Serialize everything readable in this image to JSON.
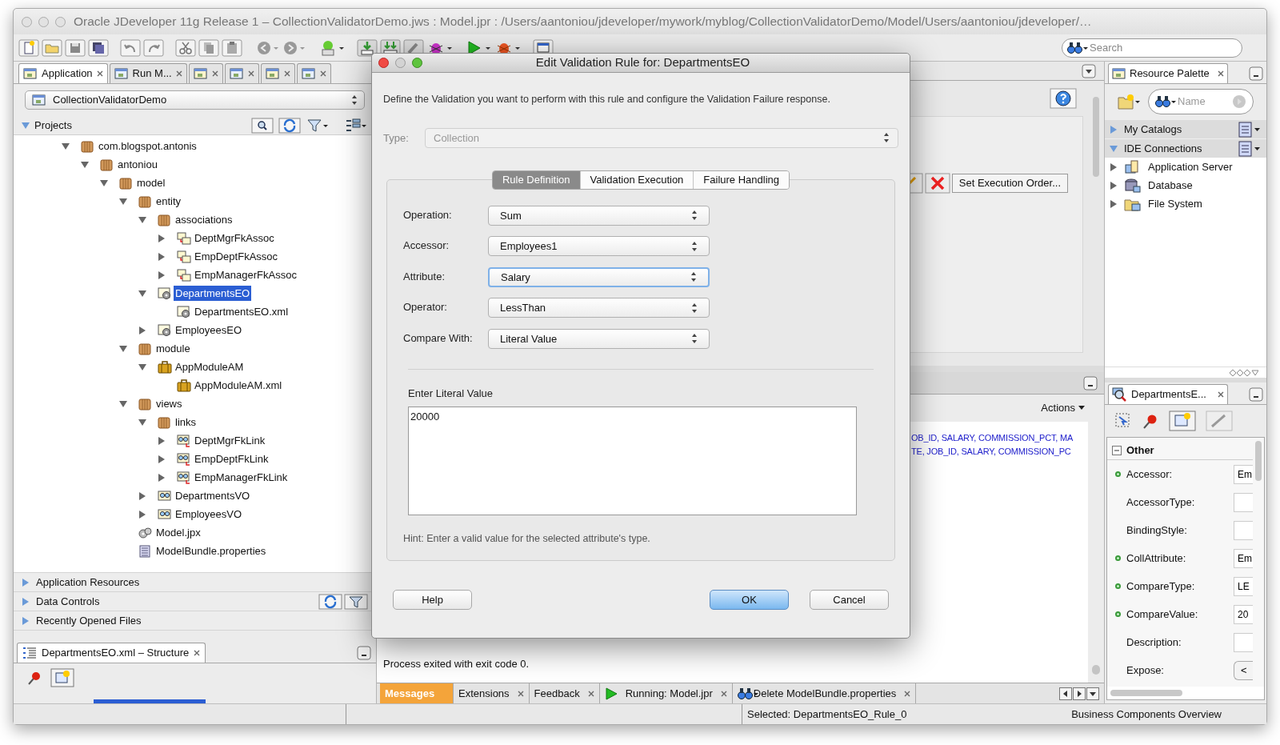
{
  "window": {
    "title": "Oracle JDeveloper 11g Release 1 – CollectionValidatorDemo.jws : Model.jpr : /Users/aantoniou/jdeveloper/mywork/myblog/CollectionValidatorDemo/Model/Users/aantoniou/jdeveloper/…"
  },
  "toolbar": {
    "search": {
      "placeholder": "Search"
    }
  },
  "navigator": {
    "tabs": [
      {
        "label": "Application",
        "selected": true
      },
      {
        "label": "Run M...",
        "selected": false
      },
      {
        "selected": false
      },
      {
        "selected": false
      },
      {
        "selected": false
      },
      {
        "selected": false
      }
    ],
    "application": "CollectionValidatorDemo",
    "projects_header": "Projects",
    "tree": [
      {
        "label": "com.blogspot.antonis",
        "kind": "package",
        "expanded": true,
        "selected": false,
        "children": [
          {
            "label": "antoniou",
            "kind": "package",
            "expanded": true,
            "selected": false,
            "children": [
              {
                "label": "model",
                "kind": "package",
                "expanded": true,
                "selected": false,
                "children": [
                  {
                    "label": "entity",
                    "kind": "package",
                    "expanded": true,
                    "selected": false,
                    "children": [
                      {
                        "label": "associations",
                        "kind": "package",
                        "expanded": true,
                        "selected": false,
                        "children": [
                          {
                            "label": "DeptMgrFkAssoc",
                            "kind": "association",
                            "expanded": false,
                            "selected": false
                          },
                          {
                            "label": "EmpDeptFkAssoc",
                            "kind": "association",
                            "expanded": false,
                            "selected": false
                          },
                          {
                            "label": "EmpManagerFkAssoc",
                            "kind": "association",
                            "expanded": false,
                            "selected": false
                          }
                        ]
                      },
                      {
                        "label": "DepartmentsEO",
                        "kind": "entity",
                        "expanded": true,
                        "selected": true,
                        "children": [
                          {
                            "label": "DepartmentsEO.xml",
                            "kind": "entity",
                            "selected": false
                          }
                        ]
                      },
                      {
                        "label": "EmployeesEO",
                        "kind": "entity",
                        "expanded": false,
                        "selected": false
                      }
                    ]
                  },
                  {
                    "label": "module",
                    "kind": "package",
                    "expanded": true,
                    "selected": false,
                    "children": [
                      {
                        "label": "AppModuleAM",
                        "kind": "module",
                        "expanded": true,
                        "selected": false,
                        "children": [
                          {
                            "label": "AppModuleAM.xml",
                            "kind": "module",
                            "selected": false
                          }
                        ]
                      }
                    ]
                  },
                  {
                    "label": "views",
                    "kind": "package",
                    "expanded": true,
                    "selected": false,
                    "children": [
                      {
                        "label": "links",
                        "kind": "package",
                        "expanded": true,
                        "selected": false,
                        "children": [
                          {
                            "label": "DeptMgrFkLink",
                            "kind": "link",
                            "expanded": false,
                            "selected": false
                          },
                          {
                            "label": "EmpDeptFkLink",
                            "kind": "link",
                            "expanded": false,
                            "selected": false
                          },
                          {
                            "label": "EmpManagerFkLink",
                            "kind": "link",
                            "expanded": false,
                            "selected": false
                          }
                        ]
                      },
                      {
                        "label": "DepartmentsVO",
                        "kind": "view",
                        "expanded": false,
                        "selected": false
                      },
                      {
                        "label": "EmployeesVO",
                        "kind": "view",
                        "expanded": false,
                        "selected": false
                      }
                    ]
                  },
                  {
                    "label": "Model.jpx",
                    "kind": "project",
                    "selected": false
                  },
                  {
                    "label": "ModelBundle.properties",
                    "kind": "properties",
                    "selected": false
                  }
                ]
              }
            ]
          }
        ]
      }
    ],
    "accordions": [
      {
        "label": "Application Resources",
        "expanded": false
      },
      {
        "label": "Data Controls",
        "expanded": false
      },
      {
        "label": "Recently Opened Files",
        "expanded": false
      }
    ]
  },
  "structure": {
    "tab": "DepartmentsEO.xml – Structure"
  },
  "editor": {
    "button": "Set Execution Order..."
  },
  "log": {
    "actions": "Actions",
    "lines": [
      "OB_ID, SALARY, COMMISSION_PCT, MA",
      "TE, JOB_ID, SALARY, COMMISSION_PC"
    ],
    "exit_message": "Process exited with exit code 0.",
    "tabs": [
      {
        "label": "Messages",
        "kind": "plain",
        "selected": true
      },
      {
        "label": "Extensions",
        "kind": "plain",
        "selected": false
      },
      {
        "label": "Feedback",
        "kind": "plain",
        "selected": false
      },
      {
        "label": "Running: Model.jpr",
        "kind": "run",
        "selected": false
      },
      {
        "label": "Delete ModelBundle.properties",
        "kind": "find",
        "selected": false
      }
    ]
  },
  "resource_palette": {
    "tab": "Resource Palette",
    "search": {
      "placeholder": "Name"
    },
    "sections": [
      {
        "label": "My Catalogs",
        "expanded": false
      },
      {
        "label": "IDE Connections",
        "expanded": true,
        "children": [
          {
            "label": "Application Server",
            "kind": "server"
          },
          {
            "label": "Database",
            "kind": "database"
          },
          {
            "label": "File System",
            "kind": "folder"
          }
        ]
      }
    ]
  },
  "inspector": {
    "tab": "DepartmentsE...",
    "group": "Other",
    "properties": [
      {
        "name": "Accessor:",
        "required": true,
        "kind": "field",
        "value": "Em"
      },
      {
        "name": "AccessorType:",
        "required": false,
        "kind": "field"
      },
      {
        "name": "BindingStyle:",
        "required": false,
        "kind": "field"
      },
      {
        "name": "CollAttribute:",
        "required": true,
        "kind": "field",
        "value": "Em"
      },
      {
        "name": "CompareType:",
        "required": true,
        "kind": "field",
        "value": "LE"
      },
      {
        "name": "CompareValue:",
        "required": true,
        "kind": "field",
        "value": "20"
      },
      {
        "name": "Description:",
        "required": false,
        "kind": "field"
      },
      {
        "name": "Expose:",
        "required": false,
        "kind": "button",
        "value": "<"
      }
    ]
  },
  "status_bar": {
    "left": "Selected: DepartmentsEO_Rule_0",
    "right": "Business Components Overview"
  },
  "dialog": {
    "title": "Edit Validation Rule for: DepartmentsEO",
    "description": "Define the Validation you want to perform with this rule and configure the Validation Failure response.",
    "type": {
      "label": "Type:",
      "value": "Collection",
      "disabled": true
    },
    "tabs": [
      {
        "label": "Rule Definition",
        "selected": true
      },
      {
        "label": "Validation Execution",
        "selected": false
      },
      {
        "label": "Failure Handling",
        "selected": false
      }
    ],
    "fields": [
      {
        "label": "Operation:",
        "value": "Sum",
        "focused": false
      },
      {
        "label": "Accessor:",
        "value": "Employees1",
        "focused": false
      },
      {
        "label": "Attribute:",
        "value": "Salary",
        "focused": true
      },
      {
        "label": "Operator:",
        "value": "LessThan",
        "focused": false
      },
      {
        "label": "Compare With:",
        "value": "Literal Value",
        "focused": false
      }
    ],
    "literal": {
      "label": "Enter Literal Value",
      "value": "20000"
    },
    "hint": "Hint: Enter a valid value for the selected attribute's type.",
    "buttons": [
      {
        "label": "Help",
        "kind": "plain"
      },
      {
        "label": "OK",
        "kind": "default"
      },
      {
        "label": "Cancel",
        "kind": "plain"
      }
    ]
  }
}
